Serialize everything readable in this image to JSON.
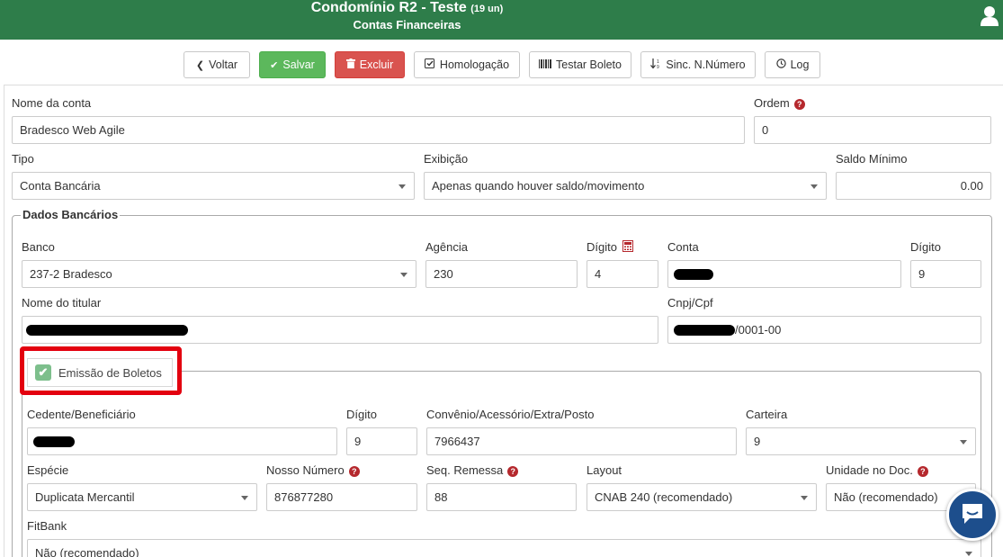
{
  "header": {
    "title": "Condomínio R2 - Teste",
    "units": "(19 un)",
    "subtitle": "Contas Financeiras",
    "user_icon": "user-icon"
  },
  "toolbar": {
    "back": "Voltar",
    "save": "Salvar",
    "delete": "Excluir",
    "homolog": "Homologação",
    "test_boleto": "Testar Boleto",
    "sync": "Sinc. N.Número",
    "log": "Log"
  },
  "account": {
    "name_label": "Nome da conta",
    "name_value": "Bradesco Web Agile",
    "order_label": "Ordem",
    "order_value": "0",
    "type_label": "Tipo",
    "type_value": "Conta Bancária",
    "display_label": "Exibição",
    "display_value": "Apenas quando houver saldo/movimento",
    "min_balance_label": "Saldo Mínimo",
    "min_balance_value": "0.00"
  },
  "bank": {
    "legend": "Dados Bancários",
    "bank_label": "Banco",
    "bank_value": "237-2 Bradesco",
    "agency_label": "Agência",
    "agency_value": "230",
    "agency_digit_label": "Dígito",
    "agency_digit_value": "4",
    "account_label": "Conta",
    "account_digit_label": "Dígito",
    "account_digit_value": "9",
    "holder_label": "Nome do titular",
    "cnpj_label": "Cnpj/Cpf",
    "cnpj_suffix": "/0001-00"
  },
  "boleto": {
    "checkbox_label": "Emissão de Boletos",
    "cedente_label": "Cedente/Beneficiário",
    "cedente_digit_label": "Dígito",
    "cedente_digit_value": "9",
    "convenio_label": "Convênio/Acessório/Extra/Posto",
    "convenio_value": "7966437",
    "carteira_label": "Carteira",
    "carteira_value": "9",
    "especie_label": "Espécie",
    "especie_value": "Duplicata Mercantil",
    "nosso_numero_label": "Nosso Número",
    "nosso_numero_value": "876877280",
    "seq_remessa_label": "Seq. Remessa",
    "seq_remessa_value": "88",
    "layout_label": "Layout",
    "layout_value": "CNAB 240 (recomendado)",
    "unidade_label": "Unidade no Doc.",
    "unidade_value": "Não (recomendado)",
    "fitbank_label": "FitBank",
    "fitbank_value": "Não (recomendado)"
  },
  "colors": {
    "header_bg": "#2e7d4a",
    "save_green": "#5cb85c",
    "delete_red": "#d9534f",
    "highlight_red": "#e3000f",
    "help_red": "#b5282d",
    "chat_blue": "#1d4e8c"
  }
}
